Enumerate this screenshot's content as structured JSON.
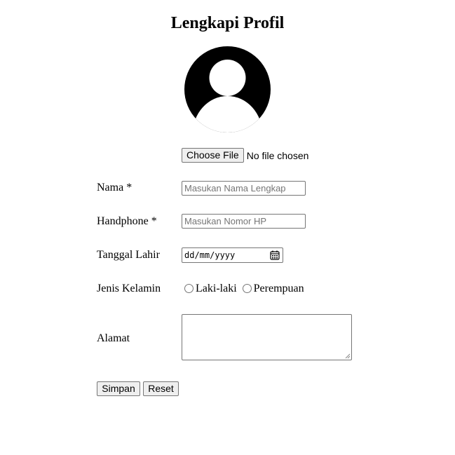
{
  "page": {
    "title": "Lengkapi Profil"
  },
  "avatar": {
    "icon": "default-user-avatar-icon"
  },
  "photo_upload": {
    "button_label": "Choose File",
    "status_text": "No file chosen"
  },
  "form": {
    "nama": {
      "label": "Nama *",
      "placeholder": "Masukan Nama Lengkap",
      "value": ""
    },
    "handphone": {
      "label": "Handphone *",
      "placeholder": "Masukan Nomor HP",
      "value": ""
    },
    "tanggal_lahir": {
      "label": "Tanggal Lahir",
      "placeholder": "dd/mm/yyyy",
      "icon": "calendar-icon"
    },
    "jenis_kelamin": {
      "label": "Jenis Kelamin",
      "options": [
        {
          "label": "Laki-laki",
          "selected": false
        },
        {
          "label": "Perempuan",
          "selected": false
        }
      ]
    },
    "alamat": {
      "label": "Alamat",
      "value": ""
    }
  },
  "actions": {
    "save_label": "Simpan",
    "reset_label": "Reset"
  }
}
